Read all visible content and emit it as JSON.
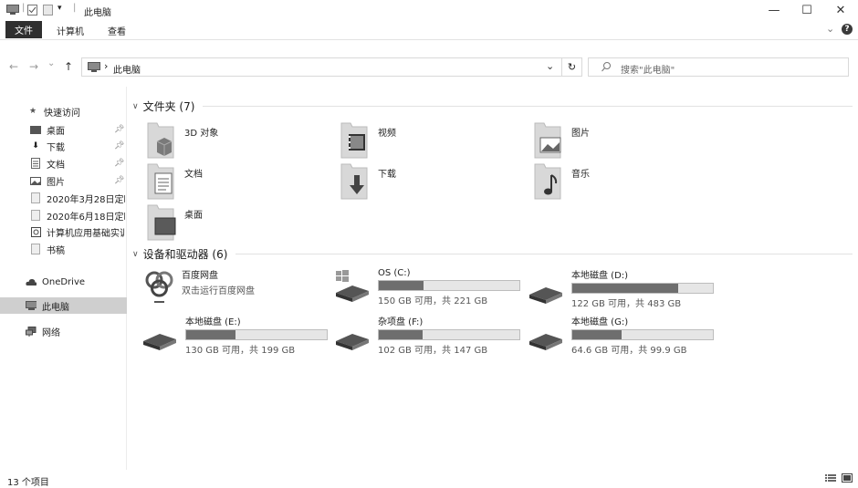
{
  "window": {
    "title": "此电脑",
    "title_separator": "|",
    "minimize": "—",
    "maximize": "☐",
    "close": "✕"
  },
  "ribbon": {
    "tabs": [
      "文件",
      "计算机",
      "查看"
    ],
    "expand": "⌄",
    "help": "?"
  },
  "address": {
    "back": "←",
    "forward": "→",
    "recent": "⌄",
    "up": "↑",
    "path_separator": "›",
    "location": "此电脑",
    "dropdown": "⌄",
    "refresh": "↻",
    "search_placeholder": "搜索\"此电脑\""
  },
  "nav": {
    "quick_access": "快速访问",
    "items": [
      {
        "label": "桌面",
        "pinned": true
      },
      {
        "label": "下载",
        "pinned": true
      },
      {
        "label": "文档",
        "pinned": true
      },
      {
        "label": "图片",
        "pinned": true
      },
      {
        "label": "2020年3月28日定时",
        "pinned": false
      },
      {
        "label": "2020年6月18日定时",
        "pinned": false
      },
      {
        "label": "计算机应用基础实训",
        "pinned": false
      },
      {
        "label": "书稿",
        "pinned": false
      }
    ],
    "onedrive": "OneDrive",
    "this_pc": "此电脑",
    "network": "网络"
  },
  "folders_group": {
    "title": "文件夹 (7)",
    "items": [
      "3D 对象",
      "视频",
      "图片",
      "文档",
      "下载",
      "音乐",
      "桌面"
    ]
  },
  "drives_group": {
    "title": "设备和驱动器 (6)",
    "baidu": {
      "name": "百度网盘",
      "desc": "双击运行百度网盘"
    },
    "drives": [
      {
        "name": "OS (C:)",
        "free": "150 GB 可用，共 221 GB",
        "used_fraction": 0.32
      },
      {
        "name": "本地磁盘 (D:)",
        "free": "122 GB 可用，共 483 GB",
        "used_fraction": 0.75
      },
      {
        "name": "本地磁盘 (E:)",
        "free": "130 GB 可用，共 199 GB",
        "used_fraction": 0.35
      },
      {
        "name": "杂项盘 (F:)",
        "free": "102 GB 可用，共 147 GB",
        "used_fraction": 0.31
      },
      {
        "name": "本地磁盘 (G:)",
        "free": "64.6 GB 可用，共 99.9 GB",
        "used_fraction": 0.35
      }
    ]
  },
  "status": {
    "item_count": "13 个项目"
  },
  "colors": {
    "bar_fill": "#6e6e6e",
    "selected_bg": "#cfcfcf"
  }
}
